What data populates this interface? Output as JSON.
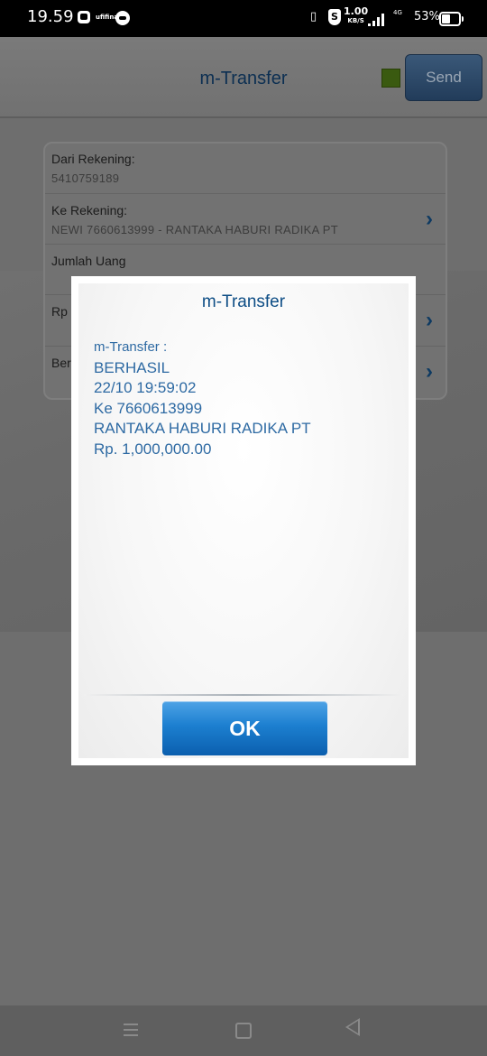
{
  "status_bar": {
    "time": "19.59",
    "notification_badge": "ufifina",
    "network_speed": "1.00",
    "network_unit": "KB/S",
    "network_type": "4G",
    "battery_percent": "53%",
    "battery_level": 0.53
  },
  "header": {
    "title": "m-Transfer",
    "status_color": "#3a5a10",
    "send_label": "Send"
  },
  "form": {
    "from_account": {
      "label": "Dari Rekening:",
      "value": "5410759189"
    },
    "to_account": {
      "label": "Ke Rekening:",
      "value": "NEWI 7660613999 - RANTAKA HABURI RADIKA PT"
    },
    "amount": {
      "label": "Jumlah Uang",
      "value": ""
    },
    "currency": {
      "label": "Rp"
    },
    "news": {
      "label": "Beri"
    }
  },
  "dialog": {
    "title": "m-Transfer",
    "lines": [
      "m-Transfer :",
      "BERHASIL",
      "22/10 19:59:02",
      "Ke 7660613999",
      "RANTAKA HABURI RADIKA PT",
      "Rp. 1,000,000.00"
    ],
    "ok_label": "OK"
  },
  "nav": {
    "menu_icon": "recent-apps-icon",
    "home_icon": "home-icon",
    "back_icon": "back-icon"
  },
  "colors": {
    "accent": "#0d4d85",
    "message_text": "#2e6aa3",
    "ok_button": "#1c7fd0"
  }
}
